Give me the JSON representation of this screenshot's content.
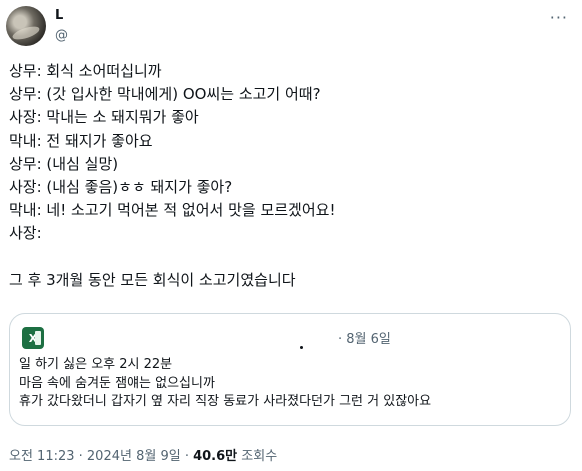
{
  "author": {
    "name": "L",
    "handle": "@"
  },
  "more_glyph": "···",
  "lines": [
    "상무: 회식 소어떠십니까",
    "상무: (갓 입사한 막내에게) OO씨는 소고기 어때?",
    "사장: 막내는 소 돼지뭐가 좋아",
    "막내: 전 돼지가 좋아요",
    "상무: (내심 실망)",
    "사장: (내심 좋음)ㅎㅎ 돼지가 좋아?",
    "막내: 네! 소고기 먹어본 적 없어서 맛을 모르겠어요!",
    "사장:"
  ],
  "summary": "그 후 3개월 동안 모든 회식이 소고기였습니다",
  "quote": {
    "icon": "excel-icon",
    "date": "· 8월 6일",
    "lines": [
      "일 하기 싫은 오후 2시 22분",
      "마음 속에 숨겨둔 잼얘는 없으십니까",
      "휴가 갔다왔더니 갑자기 옆 자리 직장 동료가 사라졌다던가 그런 거 있잖아요"
    ]
  },
  "footer": {
    "time": "오전 11:23 · 2024년 8월 9일 · ",
    "views": "40.6만",
    "views_label": " 조회수"
  }
}
